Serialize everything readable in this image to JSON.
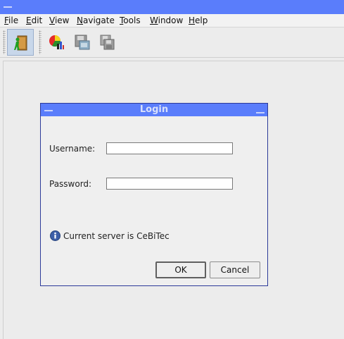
{
  "menubar": {
    "items": [
      {
        "label": "File",
        "mnemonic": "F"
      },
      {
        "label": "Edit",
        "mnemonic": "E"
      },
      {
        "label": "View",
        "mnemonic": "V"
      },
      {
        "label": "Navigate",
        "mnemonic": "N"
      },
      {
        "label": "Tools",
        "mnemonic": "T"
      },
      {
        "label": "Window",
        "mnemonic": "W"
      },
      {
        "label": "Help",
        "mnemonic": "H"
      }
    ]
  },
  "toolbar": {
    "buttons": [
      {
        "icon": "login-door-icon",
        "active": true
      },
      {
        "icon": "chart-icon",
        "active": false
      },
      {
        "icon": "save-icon",
        "active": false
      },
      {
        "icon": "save-all-icon",
        "active": false
      }
    ]
  },
  "dialog": {
    "title": "Login",
    "username_label": "Username:",
    "username_value": "",
    "password_label": "Password:",
    "password_value": "",
    "info_text": "Current server is CeBiTec",
    "ok_label": "OK",
    "cancel_label": "Cancel"
  },
  "colors": {
    "titlebar": "#5a7dfb",
    "dialog_border": "#2c3a99",
    "background": "#ececec"
  }
}
